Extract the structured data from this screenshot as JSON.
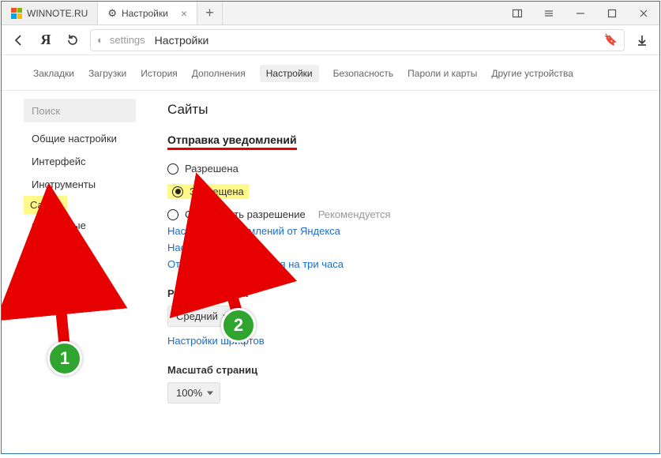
{
  "window": {
    "tabs": [
      {
        "label": "WINNOTE.RU"
      },
      {
        "label": "Настройки"
      }
    ]
  },
  "address": {
    "url_key": "settings",
    "url_title": "Настройки"
  },
  "nav": {
    "items": [
      "Закладки",
      "Загрузки",
      "История",
      "Дополнения",
      "Настройки",
      "Безопасность",
      "Пароли и карты",
      "Другие устройства"
    ],
    "active_index": 4
  },
  "sidebar": {
    "search_placeholder": "Поиск",
    "items": [
      "Общие настройки",
      "Интерфейс",
      "Инструменты",
      "Сайты",
      "Системные"
    ],
    "active_index": 3
  },
  "main": {
    "title": "Сайты",
    "notifications": {
      "heading": "Отправка уведомлений",
      "options": [
        {
          "label": "Разрешена",
          "selected": false
        },
        {
          "label": "Запрещена",
          "selected": true
        },
        {
          "label": "Спрашивать разрешение",
          "selected": false,
          "recommended": "Рекомендуется"
        }
      ],
      "links": [
        "Настройки уведомлений от Яндекса",
        "Настройки сайтов",
        "Отключить уведомления на три часа"
      ]
    },
    "font_size": {
      "heading": "Размер шрифта",
      "value": "Средний",
      "link": "Настройки шрифтов"
    },
    "page_scale": {
      "heading": "Масштаб страниц",
      "value": "100%"
    }
  },
  "annotations": {
    "b1": "1",
    "b2": "2"
  }
}
